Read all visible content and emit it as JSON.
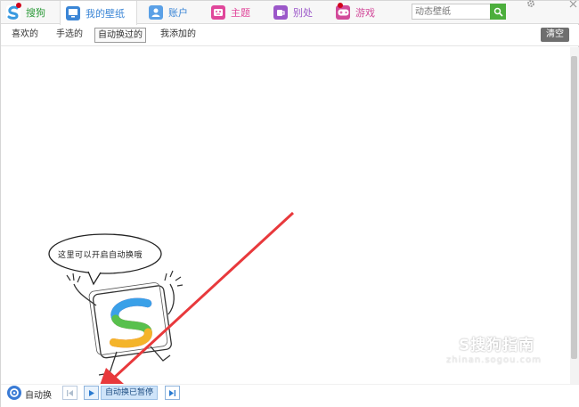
{
  "tabs": [
    {
      "label": "搜狗",
      "icon": "sogou-logo-icon",
      "color": "#2e9a3a"
    },
    {
      "label": "我的壁纸",
      "icon": "monitor-icon",
      "color": "#3b86d6"
    },
    {
      "label": "账户",
      "icon": "user-icon",
      "color": "#5aa0e6"
    },
    {
      "label": "主题",
      "icon": "theme-face-icon",
      "color": "#e0479b"
    },
    {
      "label": "别处",
      "icon": "cup-icon",
      "color": "#9b57c9"
    },
    {
      "label": "游戏",
      "icon": "gamepad-icon",
      "color": "#d24a9a"
    }
  ],
  "search": {
    "placeholder": "动态壁纸"
  },
  "subtabs": [
    "喜欢的",
    "手选的",
    "自动换过的",
    "我添加的"
  ],
  "clear_label": "清空",
  "mascot": {
    "bubble_text": "这里可以开启自动换哦"
  },
  "watermark": {
    "brand": "S搜狗指南",
    "url": "zhinan.sogou.com"
  },
  "bottom": {
    "auto_label": "自动换",
    "paused_label": "自动换已暂停"
  },
  "colors": {
    "accent": "#3b86d6",
    "arrow": "#e8393c",
    "search_button": "#4cae3c"
  }
}
